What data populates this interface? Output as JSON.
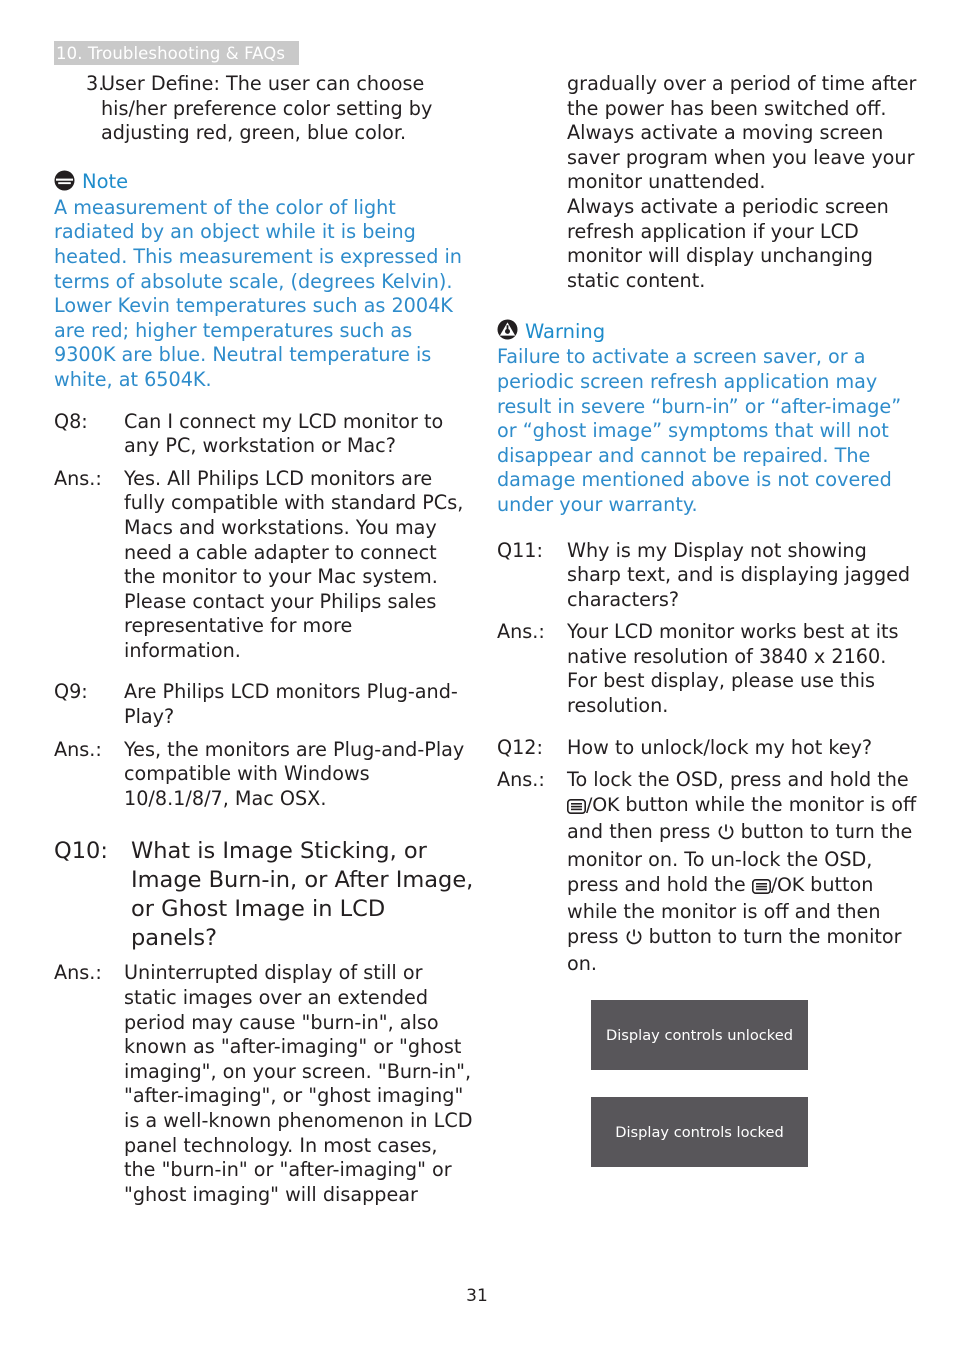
{
  "header": {
    "chapter": "10. Troubleshooting & FAQs",
    "bar_color": "#c9c9c9",
    "text_color": "#ffffff"
  },
  "colors": {
    "body_text": "#231f20",
    "note_accent": "#1e8ccb",
    "note_body": "#2e8ccb",
    "osd_box_bg": "#58565a",
    "osd_box_text": "#ffffff"
  },
  "left_column": {
    "list_item": {
      "number": "3.",
      "text": "User Define: The user can choose his/her preference color setting by adjusting red, green, blue color."
    },
    "note": {
      "icon": "note-circle-icon",
      "title": "Note",
      "body": "A measurement of the color of light radiated by an object while it is being heated. This measurement is expressed in terms of absolute scale, (degrees Kelvin). Lower Kevin temperatures such as 2004K are red; higher temperatures such as 9300K are blue. Neutral temperature is white, at 6504K."
    },
    "qa": [
      {
        "label": "Q8:",
        "text": "Can I connect my LCD monitor to any PC, workstation or Mac?"
      },
      {
        "label": "Ans.:",
        "text": "Yes. All Philips LCD monitors are fully compatible with standard PCs, Macs and workstations. You may need a cable adapter to connect the monitor to your Mac system. Please contact your Philips sales representative for more information."
      },
      {
        "label": "Q9:",
        "text": "Are Philips LCD monitors Plug-and- Play?"
      },
      {
        "label": "Ans.:",
        "text": "Yes, the monitors are Plug-and-Play compatible with Windows 10/8.1/8/7, Mac OSX."
      }
    ],
    "q10": {
      "label": "Q10:",
      "text": "What is Image Sticking, or Image Burn-in, or After Image, or Ghost Image in LCD panels?"
    },
    "q10_answer": {
      "label": "Ans.:",
      "text": "Uninterrupted display of still or static images over an extended period may cause \"burn-in\", also known as \"after-imaging\" or \"ghost imaging\", on your screen. \"Burn-in\", \"after-imaging\", or \"ghost imaging\" is a well-known phenomenon in LCD panel technology. In most cases, the \"burn-in\" or \"after-imaging\" or \"ghost imaging\" will disappear"
    }
  },
  "right_column": {
    "continuation": "gradually over a period of time after the power has been switched off.\nAlways activate a moving screen saver program when you leave your monitor unattended.\nAlways activate a periodic screen refresh application if your LCD monitor will display unchanging static content.",
    "continuation_lines": [
      "gradually over a period of time after the power has been switched off.",
      "Always activate a moving screen saver program when you leave your monitor unattended.",
      "Always activate a periodic screen refresh application if your LCD monitor will display unchanging static content."
    ],
    "warning": {
      "icon": "warning-triangle-icon",
      "title": "Warning",
      "body": "Failure to activate a screen saver, or a periodic screen refresh application may result in severe “burn-in” or “after-image” or “ghost image” symptoms that will not disappear and cannot be repaired. The damage mentioned above is not covered under your warranty."
    },
    "qa": [
      {
        "label": "Q11:",
        "text": "Why is my Display not showing sharp text, and is displaying jagged characters?"
      },
      {
        "label": "Ans.:",
        "text": "Your LCD monitor works best at its native resolution of 3840 x 2160. For best display, please use this resolution."
      },
      {
        "label": "Q12:",
        "text": "How to unlock/lock my hot key?"
      }
    ],
    "q12_answer": {
      "label": "Ans.:",
      "part1": "To lock the OSD, press and hold the ",
      "ok_label_1": "/OK",
      "part2": " button while the monitor is off and then press ",
      "part3": " button to turn the monitor on. To un-lock the OSD, press and hold the ",
      "ok_label_2": "/OK",
      "part4": " button while the monitor is off and then press ",
      "part5": " button to turn the monitor on.",
      "menu_icon": "osd-menu-icon",
      "power_icon": "power-icon"
    },
    "osd_boxes": [
      {
        "label": "Display controls unlocked"
      },
      {
        "label": "Display controls locked"
      }
    ]
  },
  "footer": {
    "page_number": "31"
  }
}
